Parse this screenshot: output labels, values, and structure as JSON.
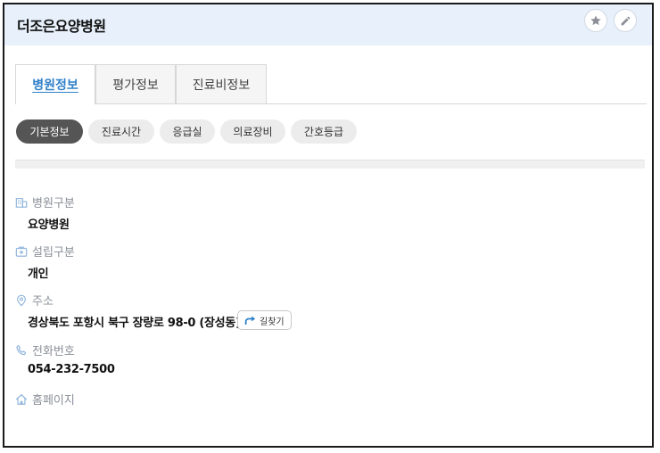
{
  "header": {
    "title": "더조은요양병원"
  },
  "tabs": [
    {
      "label": "병원정보",
      "active": true
    },
    {
      "label": "평가정보",
      "active": false
    },
    {
      "label": "진료비정보",
      "active": false
    }
  ],
  "subtabs": [
    {
      "label": "기본정보",
      "active": true
    },
    {
      "label": "진료시간",
      "active": false
    },
    {
      "label": "응급실",
      "active": false
    },
    {
      "label": "의료장비",
      "active": false
    },
    {
      "label": "간호등급",
      "active": false
    }
  ],
  "fields": {
    "category": {
      "label": "병원구분",
      "value": "요양병원",
      "icon": "building-icon"
    },
    "establishment": {
      "label": "설립구분",
      "value": "개인",
      "icon": "first-aid-icon"
    },
    "address": {
      "label": "주소",
      "value": "경상북도 포항시 북구 장량로 98-0 (장성동)",
      "icon": "location-pin-icon"
    },
    "phone": {
      "label": "전화번호",
      "value": "054-232-7500",
      "icon": "phone-icon"
    },
    "homepage": {
      "label": "홈페이지",
      "icon": "home-icon"
    }
  },
  "route_button": {
    "label": "길찾기",
    "icon": "route-arrow-icon"
  },
  "colors": {
    "header_bg": "#e7f0fb",
    "accent": "#2f80c9",
    "label_gray": "#8a8f98",
    "active_pill": "#555555"
  }
}
